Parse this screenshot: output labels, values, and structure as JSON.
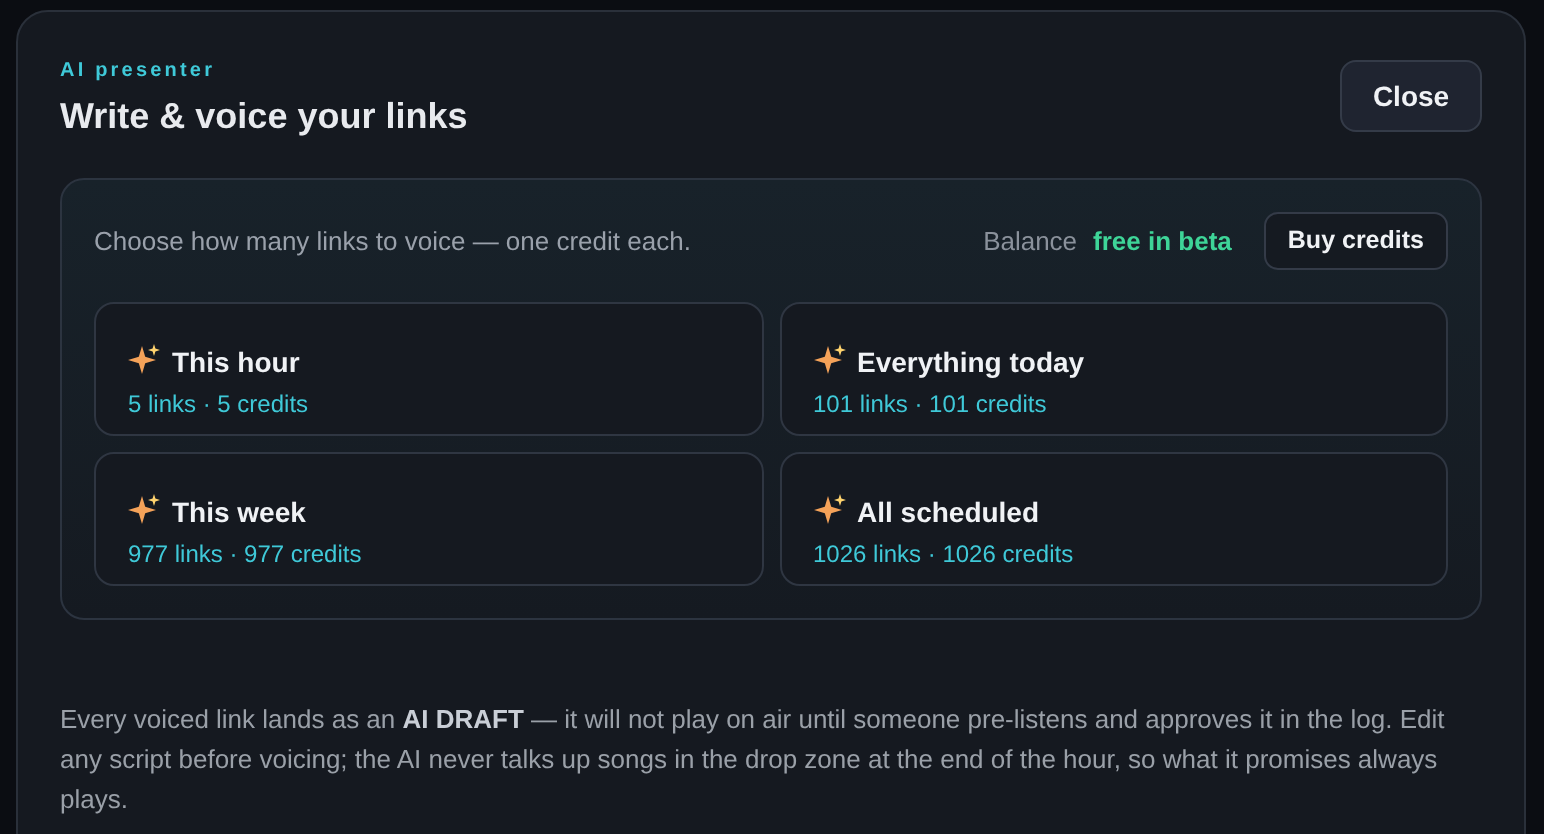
{
  "dialog": {
    "eyebrow": "AI presenter",
    "title": "Write & voice your links",
    "close_button": "Close"
  },
  "panel": {
    "prompt": "Choose how many links to voice — one credit each.",
    "balance_label": "Balance",
    "balance_value": "free in beta",
    "buy_button": "Buy credits",
    "options": [
      {
        "label": "This hour",
        "detail": "5 links · 5 credits"
      },
      {
        "label": "Everything today",
        "detail": "101 links · 101 credits"
      },
      {
        "label": "This week",
        "detail": "977 links · 977 credits"
      },
      {
        "label": "All scheduled",
        "detail": "1026 links · 1026 credits"
      }
    ]
  },
  "footnote": "Every voiced link lands as an **AI DRAFT** — it will not play on air until someone pre-listens and approves it in the log. Edit any script before voicing; the AI never talks up songs in the drop zone at the end of the hour, so what it promises always plays."
}
